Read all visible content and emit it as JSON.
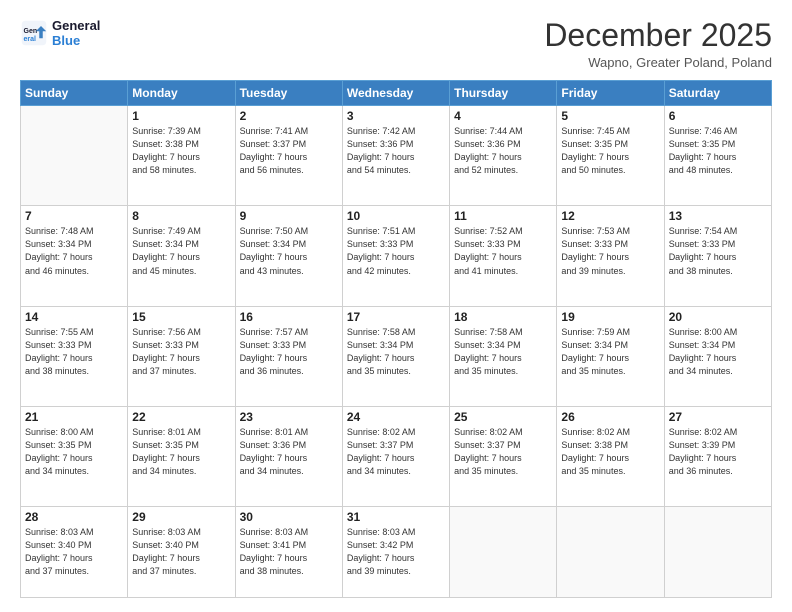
{
  "header": {
    "logo": {
      "line1": "General",
      "line2": "Blue"
    },
    "title": "December 2025",
    "location": "Wapno, Greater Poland, Poland"
  },
  "weekdays": [
    "Sunday",
    "Monday",
    "Tuesday",
    "Wednesday",
    "Thursday",
    "Friday",
    "Saturday"
  ],
  "weeks": [
    [
      {
        "num": "",
        "info": ""
      },
      {
        "num": "1",
        "info": "Sunrise: 7:39 AM\nSunset: 3:38 PM\nDaylight: 7 hours\nand 58 minutes."
      },
      {
        "num": "2",
        "info": "Sunrise: 7:41 AM\nSunset: 3:37 PM\nDaylight: 7 hours\nand 56 minutes."
      },
      {
        "num": "3",
        "info": "Sunrise: 7:42 AM\nSunset: 3:36 PM\nDaylight: 7 hours\nand 54 minutes."
      },
      {
        "num": "4",
        "info": "Sunrise: 7:44 AM\nSunset: 3:36 PM\nDaylight: 7 hours\nand 52 minutes."
      },
      {
        "num": "5",
        "info": "Sunrise: 7:45 AM\nSunset: 3:35 PM\nDaylight: 7 hours\nand 50 minutes."
      },
      {
        "num": "6",
        "info": "Sunrise: 7:46 AM\nSunset: 3:35 PM\nDaylight: 7 hours\nand 48 minutes."
      }
    ],
    [
      {
        "num": "7",
        "info": "Sunrise: 7:48 AM\nSunset: 3:34 PM\nDaylight: 7 hours\nand 46 minutes."
      },
      {
        "num": "8",
        "info": "Sunrise: 7:49 AM\nSunset: 3:34 PM\nDaylight: 7 hours\nand 45 minutes."
      },
      {
        "num": "9",
        "info": "Sunrise: 7:50 AM\nSunset: 3:34 PM\nDaylight: 7 hours\nand 43 minutes."
      },
      {
        "num": "10",
        "info": "Sunrise: 7:51 AM\nSunset: 3:33 PM\nDaylight: 7 hours\nand 42 minutes."
      },
      {
        "num": "11",
        "info": "Sunrise: 7:52 AM\nSunset: 3:33 PM\nDaylight: 7 hours\nand 41 minutes."
      },
      {
        "num": "12",
        "info": "Sunrise: 7:53 AM\nSunset: 3:33 PM\nDaylight: 7 hours\nand 39 minutes."
      },
      {
        "num": "13",
        "info": "Sunrise: 7:54 AM\nSunset: 3:33 PM\nDaylight: 7 hours\nand 38 minutes."
      }
    ],
    [
      {
        "num": "14",
        "info": "Sunrise: 7:55 AM\nSunset: 3:33 PM\nDaylight: 7 hours\nand 38 minutes."
      },
      {
        "num": "15",
        "info": "Sunrise: 7:56 AM\nSunset: 3:33 PM\nDaylight: 7 hours\nand 37 minutes."
      },
      {
        "num": "16",
        "info": "Sunrise: 7:57 AM\nSunset: 3:33 PM\nDaylight: 7 hours\nand 36 minutes."
      },
      {
        "num": "17",
        "info": "Sunrise: 7:58 AM\nSunset: 3:34 PM\nDaylight: 7 hours\nand 35 minutes."
      },
      {
        "num": "18",
        "info": "Sunrise: 7:58 AM\nSunset: 3:34 PM\nDaylight: 7 hours\nand 35 minutes."
      },
      {
        "num": "19",
        "info": "Sunrise: 7:59 AM\nSunset: 3:34 PM\nDaylight: 7 hours\nand 35 minutes."
      },
      {
        "num": "20",
        "info": "Sunrise: 8:00 AM\nSunset: 3:34 PM\nDaylight: 7 hours\nand 34 minutes."
      }
    ],
    [
      {
        "num": "21",
        "info": "Sunrise: 8:00 AM\nSunset: 3:35 PM\nDaylight: 7 hours\nand 34 minutes."
      },
      {
        "num": "22",
        "info": "Sunrise: 8:01 AM\nSunset: 3:35 PM\nDaylight: 7 hours\nand 34 minutes."
      },
      {
        "num": "23",
        "info": "Sunrise: 8:01 AM\nSunset: 3:36 PM\nDaylight: 7 hours\nand 34 minutes."
      },
      {
        "num": "24",
        "info": "Sunrise: 8:02 AM\nSunset: 3:37 PM\nDaylight: 7 hours\nand 34 minutes."
      },
      {
        "num": "25",
        "info": "Sunrise: 8:02 AM\nSunset: 3:37 PM\nDaylight: 7 hours\nand 35 minutes."
      },
      {
        "num": "26",
        "info": "Sunrise: 8:02 AM\nSunset: 3:38 PM\nDaylight: 7 hours\nand 35 minutes."
      },
      {
        "num": "27",
        "info": "Sunrise: 8:02 AM\nSunset: 3:39 PM\nDaylight: 7 hours\nand 36 minutes."
      }
    ],
    [
      {
        "num": "28",
        "info": "Sunrise: 8:03 AM\nSunset: 3:40 PM\nDaylight: 7 hours\nand 37 minutes."
      },
      {
        "num": "29",
        "info": "Sunrise: 8:03 AM\nSunset: 3:40 PM\nDaylight: 7 hours\nand 37 minutes."
      },
      {
        "num": "30",
        "info": "Sunrise: 8:03 AM\nSunset: 3:41 PM\nDaylight: 7 hours\nand 38 minutes."
      },
      {
        "num": "31",
        "info": "Sunrise: 8:03 AM\nSunset: 3:42 PM\nDaylight: 7 hours\nand 39 minutes."
      },
      {
        "num": "",
        "info": ""
      },
      {
        "num": "",
        "info": ""
      },
      {
        "num": "",
        "info": ""
      }
    ]
  ]
}
